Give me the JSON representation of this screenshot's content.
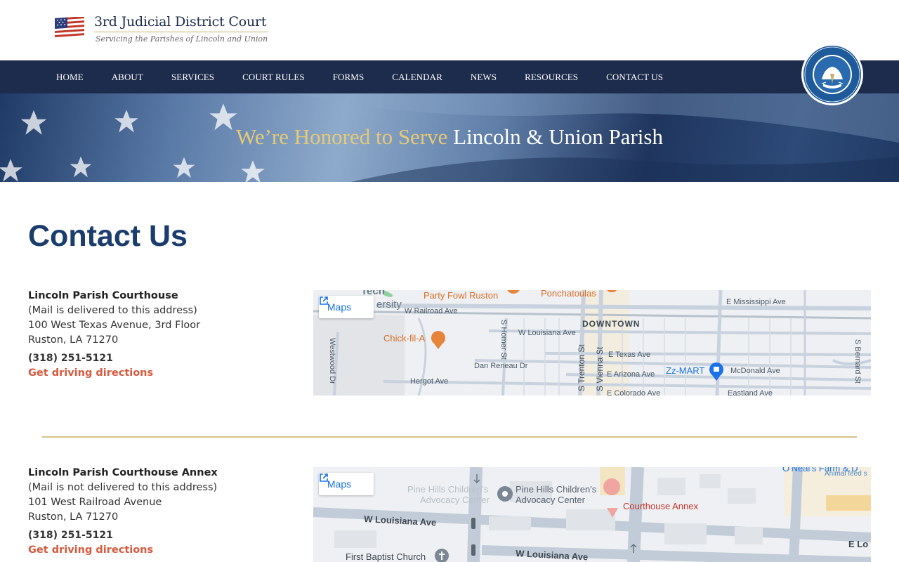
{
  "site": {
    "title": "3rd Judicial District Court",
    "subtitle": "Servicing the Parishes of Lincoln and Union"
  },
  "nav": {
    "items": [
      "HOME",
      "ABOUT",
      "SERVICES",
      "COURT RULES",
      "FORMS",
      "CALENDAR",
      "NEWS",
      "RESOURCES",
      "CONTACT US"
    ]
  },
  "seal": {
    "text": "STATE OF LOUISIANA · UNION · JUSTICE · CONFIDENCE"
  },
  "banner": {
    "text_gold": "We’re Honored to Serve",
    "text_white": "Lincoln & Union Parish"
  },
  "page": {
    "title": "Contact Us"
  },
  "locations": [
    {
      "name": "Lincoln Parish Courthouse",
      "note": "(Mail is delivered to this address)",
      "address1": "100 West Texas Avenue, 3rd Floor",
      "address2": "Ruston, LA 71270",
      "phone": "(318) 251-5121",
      "directions": "Get driving directions",
      "map": {
        "button": "Maps",
        "labels": {
          "party_fowl": "Party Fowl Ruston",
          "ponchatoulas": "Ponchatoulas",
          "mississippi": "E Mississippi Ave",
          "tech": "Tech",
          "ersity": "ersity",
          "railroad": "W Railroad Ave",
          "downtown": "DOWNTOWN",
          "louisiana": "W Louisiana Ave",
          "chickfila": "Chick-fil-A",
          "homer": "S Homer St",
          "trenton": "S Trenton St",
          "vienna": "S Vienna St",
          "texas": "E Texas Ave",
          "westwood": "Westwood Dr",
          "reneau": "Dan Reneau Dr",
          "arizona": "E Arizona Ave",
          "zzmart": "Zz-MART",
          "mcdonald": "McDonald Ave",
          "bernard": "S Bernard St",
          "hergot": "Hergot Ave",
          "colorado": "E Colorado Ave",
          "eastland": "Eastland Ave"
        }
      }
    },
    {
      "name": "Lincoln Parish Courthouse Annex",
      "note": "(Mail is not delivered to this address)",
      "address1": "101 West Railroad Avenue",
      "address2": "Ruston, LA 71270",
      "phone": "(318) 251-5121",
      "directions": "Get driving directions",
      "map": {
        "button": "Maps",
        "labels": {
          "pinehills_faded": "Pine Hills Children's",
          "advocacy_faded": "Advocacy Center",
          "pinehills": "Pine Hills Children's",
          "advocacy": "Advocacy Center",
          "annex": "Courthouse Annex",
          "oneals": "O'Neal's Farm & D",
          "animal": "Animal feed s",
          "wlouisiana1": "W Louisiana Ave",
          "wlouisiana2": "W Louisiana Ave",
          "firstbaptist": "First Baptist Church",
          "elou": "E Lo"
        }
      }
    }
  ],
  "colors": {
    "navy": "#1d2b4c",
    "title_blue": "#1a3d6e",
    "gold": "#e4c978",
    "link_red": "#d65a3e",
    "divider": "#d9c187"
  }
}
